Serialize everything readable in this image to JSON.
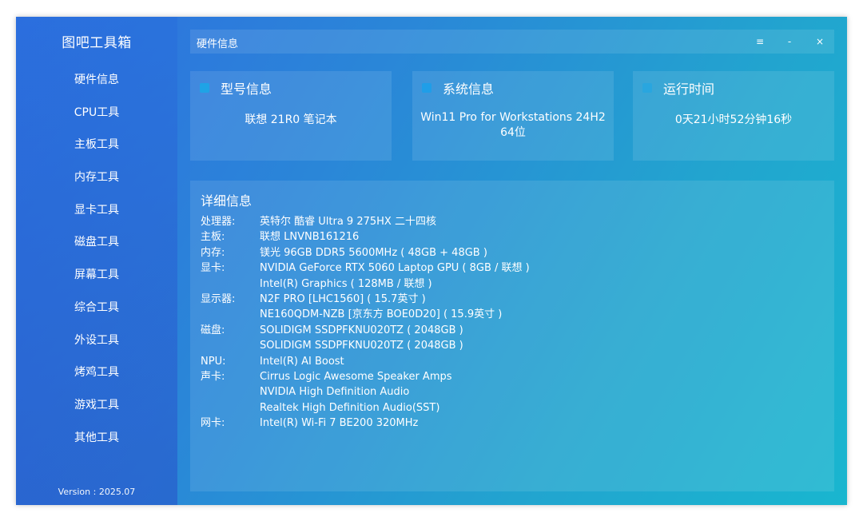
{
  "app": {
    "title": "图吧工具箱",
    "version": "Version : 2025.07"
  },
  "sidebar": {
    "items": [
      {
        "label": "硬件信息",
        "icon": "hardware-icon"
      },
      {
        "label": "CPU工具",
        "icon": "cpu-icon"
      },
      {
        "label": "主板工具",
        "icon": "motherboard-icon"
      },
      {
        "label": "内存工具",
        "icon": "memory-icon"
      },
      {
        "label": "显卡工具",
        "icon": "gpu-icon"
      },
      {
        "label": "磁盘工具",
        "icon": "disk-icon"
      },
      {
        "label": "屏幕工具",
        "icon": "monitor-icon"
      },
      {
        "label": "综合工具",
        "icon": "toolkit-icon"
      },
      {
        "label": "外设工具",
        "icon": "peripheral-icon"
      },
      {
        "label": "烤鸡工具",
        "icon": "stress-test-icon"
      },
      {
        "label": "游戏工具",
        "icon": "game-icon"
      },
      {
        "label": "其他工具",
        "icon": "misc-icon"
      }
    ]
  },
  "header": {
    "title": "硬件信息",
    "menu_glyph": "≡",
    "minimize_glyph": "-",
    "close_glyph": "×"
  },
  "cards": {
    "model": {
      "title": "型号信息",
      "value": "联想 21R0 笔记本",
      "dot_color": "#1fa3e6"
    },
    "system": {
      "title": "系统信息",
      "value": "Win11 Pro for Workstations 24H2 64位",
      "dot_color": "#1f9ee8"
    },
    "uptime": {
      "title": "运行时间",
      "value": "0天21小时52分钟16秒",
      "dot_color": "#29a6df"
    }
  },
  "detail": {
    "title": "详细信息",
    "rows": [
      {
        "label": "处理器:",
        "value": "英特尔 酷睿 Ultra 9 275HX 二十四核"
      },
      {
        "label": "主板:",
        "value": "联想 LNVNB161216"
      },
      {
        "label": "内存:",
        "value": "镁光 96GB DDR5 5600MHz ( 48GB + 48GB )"
      },
      {
        "label": "显卡:",
        "value": "NVIDIA GeForce RTX 5060 Laptop GPU ( 8GB / 联想 )"
      },
      {
        "label": "",
        "value": "Intel(R) Graphics ( 128MB / 联想 )"
      },
      {
        "label": "显示器:",
        "value": "N2F PRO [LHC1560] ( 15.7英寸 )"
      },
      {
        "label": "",
        "value": "NE160QDM-NZB [京东方 BOE0D20] ( 15.9英寸 )"
      },
      {
        "label": "磁盘:",
        "value": "SOLIDIGM SSDPFKNU020TZ ( 2048GB )"
      },
      {
        "label": "",
        "value": "SOLIDIGM SSDPFKNU020TZ ( 2048GB )"
      },
      {
        "label": "NPU:",
        "value": "Intel(R) AI Boost"
      },
      {
        "label": "声卡:",
        "value": "Cirrus Logic Awesome Speaker Amps"
      },
      {
        "label": "",
        "value": "NVIDIA High Definition Audio"
      },
      {
        "label": "",
        "value": "Realtek High Definition Audio(SST)"
      },
      {
        "label": "网卡:",
        "value": "Intel(R) Wi-Fi 7 BE200 320MHz"
      }
    ]
  }
}
